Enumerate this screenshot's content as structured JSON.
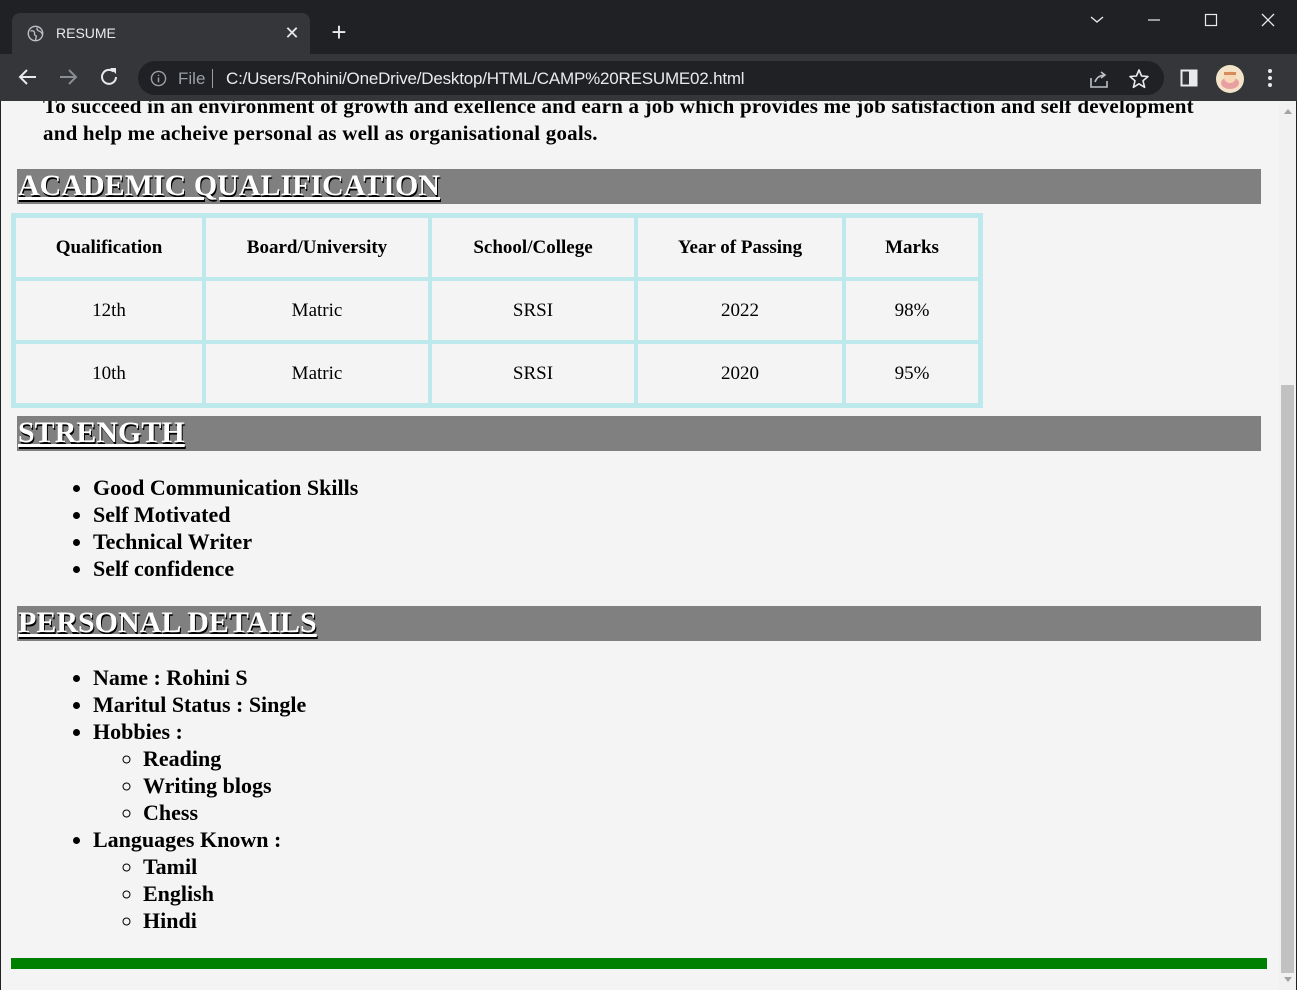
{
  "browser": {
    "tab_title": "RESUME",
    "scheme_label": "File",
    "url": "C:/Users/Rohini/OneDrive/Desktop/HTML/CAMP%20RESUME02.html",
    "close_glyph": "✕",
    "newtab_glyph": "+"
  },
  "page": {
    "objective": "To succeed in an environment of growth and exellence and earn a job which provides me job satisfaction and self development and help me acheive personal as well as organisational goals.",
    "sections": {
      "academic": "ACADEMIC QUALIFICATION",
      "strength": "STRENGTH",
      "personal": "PERSONAL DETAILS"
    },
    "qualifications": {
      "headers": [
        "Qualification",
        "Board/University",
        "School/College",
        "Year of Passing",
        "Marks"
      ],
      "rows": [
        [
          "12th",
          "Matric",
          "SRSI",
          "2022",
          "98%"
        ],
        [
          "10th",
          "Matric",
          "SRSI",
          "2020",
          "95%"
        ]
      ]
    },
    "strengths": [
      "Good Communication Skills",
      "Self Motivated",
      "Technical Writer",
      "Self confidence"
    ],
    "personal": {
      "name": "Name : Rohini S",
      "marital": "Maritul Status : Single",
      "hobbies_label": "Hobbies :",
      "hobbies": [
        "Reading",
        "Writing blogs",
        "Chess"
      ],
      "languages_label": "Languages Known :",
      "languages": [
        "Tamil",
        "English",
        "Hindi"
      ]
    }
  },
  "colors": {
    "section_bar": "#808080",
    "table_border": "#bde8ec",
    "footer_bar": "#008000",
    "page_bg": "#f4f4f4"
  }
}
